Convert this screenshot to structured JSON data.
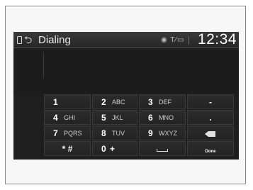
{
  "header": {
    "title": "Dialing",
    "back_glyph": "⮌",
    "status_icons": "◉ T∕▭",
    "clock": "12:34"
  },
  "keypad": {
    "keys": [
      {
        "digit": "1",
        "letters": ""
      },
      {
        "digit": "2",
        "letters": "ABC"
      },
      {
        "digit": "3",
        "letters": "DEF"
      },
      {
        "symbol": "-"
      },
      {
        "digit": "4",
        "letters": "GHI"
      },
      {
        "digit": "5",
        "letters": "JKL"
      },
      {
        "digit": "6",
        "letters": "MNO"
      },
      {
        "symbol": "."
      },
      {
        "digit": "7",
        "letters": "PQRS"
      },
      {
        "digit": "8",
        "letters": "TUV"
      },
      {
        "digit": "9",
        "letters": "WXYZ"
      },
      {
        "icon": "backspace-icon"
      },
      {
        "symbol": "* #"
      },
      {
        "digit": "0",
        "letters": "+"
      },
      {
        "icon": "space-icon"
      },
      {
        "symbol": "Done"
      }
    ]
  },
  "colors": {
    "screen_bg": "#1e1e1e",
    "key_bg": "#2a2a2a",
    "text": "#ffffff"
  }
}
